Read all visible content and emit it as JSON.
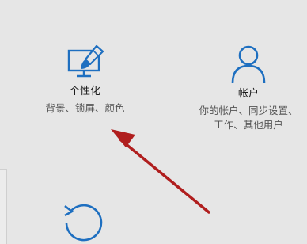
{
  "settings": {
    "tiles": [
      {
        "title": "个性化",
        "description": "背景、锁屏、颜色",
        "icon": "personalization-icon"
      },
      {
        "title": "帐户",
        "description_line1": "你的帐户、同步设置、",
        "description_line2": "工作、其他用户",
        "icon": "account-icon"
      },
      {
        "icon": "update-icon"
      }
    ]
  },
  "colors": {
    "accent": "#1e6fc0",
    "background": "#e6e6e6",
    "annotation_arrow": "#b01e1e"
  }
}
